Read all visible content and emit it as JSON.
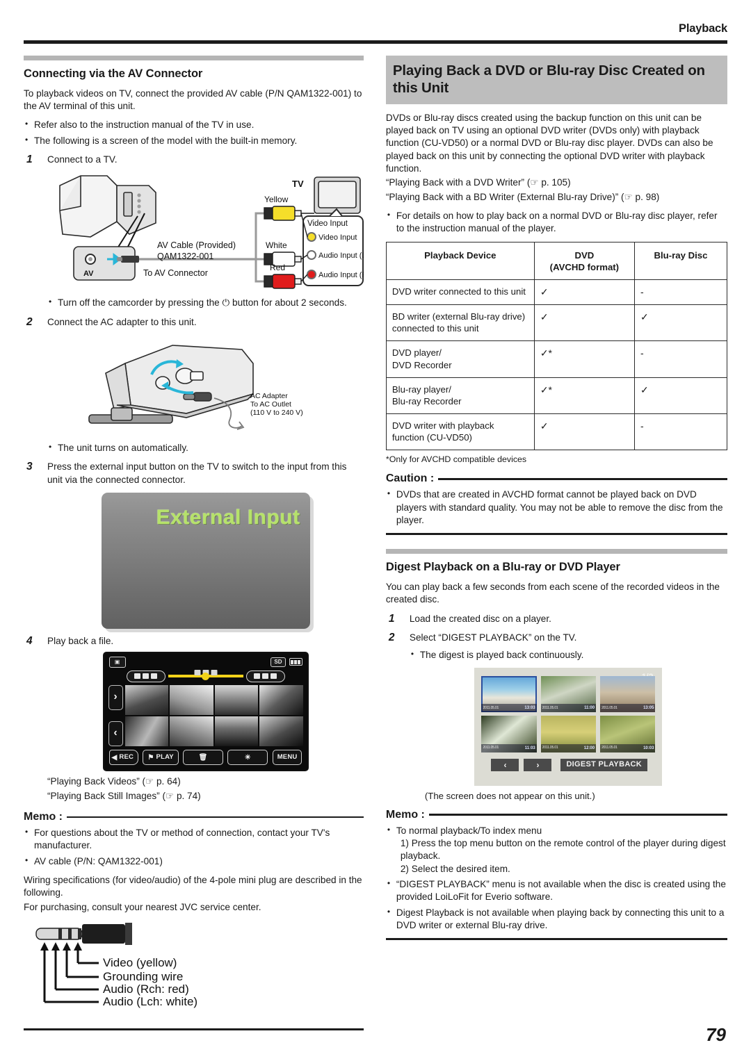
{
  "header": {
    "running_head": "Playback",
    "page_number": "79"
  },
  "left": {
    "section_title": "Connecting via the AV Connector",
    "intro": "To playback videos on TV, connect the provided AV cable (P/N QAM1322-001) to the AV terminal of this unit.",
    "intro_bullets": [
      "Refer also to the instruction manual of the TV in use.",
      "The following is a screen of the model with the built-in memory."
    ],
    "steps": [
      {
        "num": "1",
        "text": "Connect to a TV."
      },
      {
        "num": "2",
        "text": "Connect the AC adapter to this unit."
      },
      {
        "num": "3",
        "text": "Press the external input button on the TV to switch to the input from this unit via the connected connector."
      },
      {
        "num": "4",
        "text": "Play back a file."
      }
    ],
    "step1_note": "Turn off the camcorder by pressing the ⏻ button for about 2 seconds.",
    "step1_note_pre": "Turn off the camcorder by pressing the ",
    "step1_note_post": " button for about 2 seconds.",
    "step2_note": "The unit turns on automatically.",
    "av_diagram": {
      "tv_label": "TV",
      "cable_label_line1": "AV Cable (Provided)",
      "cable_label_line2": "QAM1322-001",
      "av_port_label": "AV",
      "to_av_connector": "To AV Connector",
      "plug_labels": [
        "Yellow",
        "White",
        "Red"
      ],
      "panel_title": "Video Input",
      "inputs": [
        "Video Input",
        "Audio Input (L)",
        "Audio Input (R)"
      ]
    },
    "ac_diagram": {
      "line1": "AC Adapter",
      "line2": "To AC Outlet",
      "line3": "(110 V to 240 V)"
    },
    "tv_screen": {
      "text": "External Input"
    },
    "cam_screen": {
      "sd_badge": "SD",
      "buttons": [
        {
          "label": "REC",
          "icon": "chevron-left-icon"
        },
        {
          "label": "PLAY",
          "icon": "flag-icon"
        },
        {
          "label": "",
          "icon": "trash-icon"
        },
        {
          "label": "",
          "icon": "disc-icon"
        },
        {
          "label": "MENU",
          "icon": ""
        }
      ]
    },
    "refs": [
      "“Playing Back Videos” (☞ p. 64)",
      "“Playing Back Still Images” (☞ p. 74)"
    ],
    "memo": {
      "label": "Memo :",
      "bullets": [
        "For questions about the TV or method of connection, contact your TV's manufacturer.",
        "AV cable (P/N: QAM1322-001)"
      ],
      "paragraphs": [
        "Wiring specifications (for video/audio) of the 4-pole mini plug are described in the following.",
        "For purchasing, consult your nearest JVC service center."
      ]
    },
    "plug_diagram": {
      "labels": [
        "Video (yellow)",
        "Grounding wire",
        "Audio (Rch: red)",
        "Audio (Lch: white)"
      ]
    }
  },
  "right": {
    "title": "Playing Back a DVD or Blu-ray Disc Created on this Unit",
    "intro": "DVDs or Blu-ray discs created using the backup function on this unit can be played back on TV using an optional DVD writer (DVDs only) with playback function (CU-VD50) or a normal DVD or Blu-ray disc player. DVDs can also be played back on this unit by connecting the optional DVD writer with playback function.",
    "refs": [
      "“Playing Back with a DVD Writer” (☞ p. 105)",
      "“Playing Back with a BD Writer (External Blu-ray Drive)” (☞ p. 98)"
    ],
    "intro_bullets": [
      "For details on how to play back on a normal DVD or Blu-ray disc player, refer to the instruction manual of the player."
    ],
    "table": {
      "headers": [
        "Playback Device",
        "DVD\n(AVCHD format)",
        "Blu-ray Disc"
      ],
      "header_dvd_line1": "DVD",
      "header_dvd_line2": "(AVCHD format)",
      "rows": [
        {
          "device": "DVD writer connected to this unit",
          "dvd": "✓",
          "bd": "-"
        },
        {
          "device": "BD writer (external Blu-ray drive) connected to this unit",
          "dvd": "✓",
          "bd": "✓"
        },
        {
          "device": "DVD player/\nDVD Recorder",
          "dvd": "✓*",
          "bd": "-"
        },
        {
          "device": "Blu-ray player/\nBlu-ray Recorder",
          "dvd": "✓*",
          "bd": "✓"
        },
        {
          "device": "DVD writer with playback function (CU-VD50)",
          "dvd": "✓",
          "bd": "-"
        }
      ],
      "footnote": "*Only for AVCHD compatible devices"
    },
    "caution": {
      "label": "Caution :",
      "bullets": [
        "DVDs that are created in AVCHD format cannot be played back on DVD players with standard quality. You may not be able to remove the disc from the player."
      ]
    },
    "digest_section": {
      "title": "Digest Playback on a Blu-ray or DVD Player",
      "intro": "You can play back a few seconds from each scene of the recorded videos in the created disc.",
      "steps": [
        {
          "num": "1",
          "text": "Load the created disc on a player."
        },
        {
          "num": "2",
          "text": "Select “DIGEST PLAYBACK” on the TV."
        }
      ],
      "step2_note": "The digest is played back continuously.",
      "screen": {
        "page_indicator": "1/2",
        "prev_label": "‹",
        "next_label": "›",
        "digest_label": "DIGEST PLAYBACK",
        "thumbs": [
          {
            "date": "2011.05.01",
            "time": "13:03"
          },
          {
            "date": "2011.05.01",
            "time": "11:00"
          },
          {
            "date": "2011.05.01",
            "time": "13:05"
          },
          {
            "date": "2011.05.01",
            "time": "11:03"
          },
          {
            "date": "2011.05.01",
            "time": "12:00"
          },
          {
            "date": "2011.05.01",
            "time": "10:03"
          }
        ]
      },
      "screen_caption": "(The screen does not appear on this unit.)"
    },
    "memo": {
      "label": "Memo :",
      "bullets": [
        "To normal playback/To index menu",
        "“DIGEST PLAYBACK” menu is not available when the disc is created using the provided LoiLoFit for Everio software.",
        "Digest Playback is not available when playing back by connecting this unit to a DVD writer or external Blu-ray drive."
      ],
      "sub_lines": [
        "1) Press the top menu button on the remote control of the player during digest playback.",
        "2) Select the desired item."
      ]
    }
  },
  "colors": {
    "rule_dark": "#1c1c1c",
    "section_bar": "#b5b5b5",
    "title_band": "#bdbdbd",
    "yellow": "#f2d21a",
    "green_text": "#b6e26a",
    "red": "#d81f1f",
    "cyan_arrow": "#29b6d8"
  }
}
